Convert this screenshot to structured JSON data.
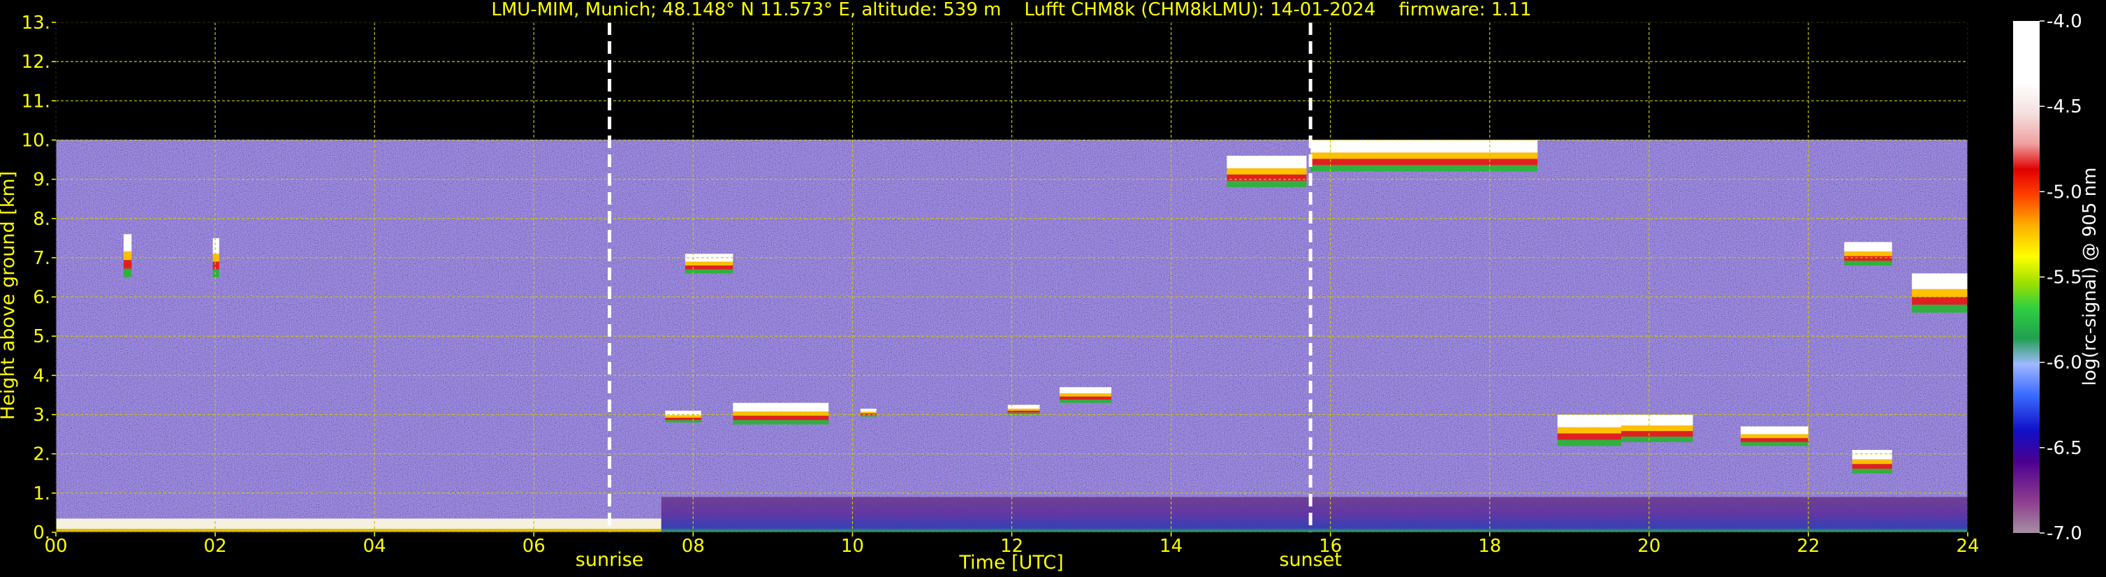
{
  "chart_data": {
    "type": "heatmap",
    "title": "LMU-MIM, Munich; 48.148° N 11.573° E, altitude: 539 m    Lufft CHM8k (CHM8kLMU): 14-01-2024    firmware: 1.11",
    "xlabel": "Time [UTC]",
    "ylabel": "Height above ground [km]",
    "xlim": [
      0,
      24
    ],
    "ylim": [
      0,
      13
    ],
    "x_ticks": [
      0,
      2,
      4,
      6,
      8,
      10,
      12,
      14,
      16,
      18,
      20,
      22,
      24
    ],
    "x_tick_labels": [
      "00",
      "02",
      "04",
      "06",
      "08",
      "10",
      "12",
      "14",
      "16",
      "18",
      "20",
      "22",
      "24"
    ],
    "y_ticks": [
      0,
      1,
      2,
      3,
      4,
      5,
      6,
      7,
      8,
      9,
      10,
      11,
      12,
      13
    ],
    "y_tick_labels": [
      "0.",
      "1.",
      "2.",
      "3.",
      "4.",
      "5.",
      "6.",
      "7.",
      "8.",
      "9.",
      "10.",
      "11.",
      "12.",
      "13."
    ],
    "grid": true,
    "data_top_km": 10,
    "markers": [
      {
        "label": "sunrise",
        "time": 6.95
      },
      {
        "label": "sunset",
        "time": 15.75
      }
    ],
    "colorbar": {
      "label": "log(rc-signal) @ 905 nm",
      "range": [
        -7.0,
        -4.0
      ],
      "ticks": [
        -4.0,
        -4.5,
        -5.0,
        -5.5,
        -6.0,
        -6.5,
        -7.0
      ],
      "tick_labels": [
        "-4.0",
        "-4.5",
        "-5.0",
        "-5.5",
        "-6.0",
        "-6.5",
        "-7.0"
      ]
    },
    "features": [
      {
        "kind": "cloud",
        "t0": 0.85,
        "t1": 0.95,
        "h0": 6.5,
        "h1": 7.6
      },
      {
        "kind": "cloud",
        "t0": 1.97,
        "t1": 2.05,
        "h0": 6.5,
        "h1": 7.5
      },
      {
        "kind": "cloud",
        "t0": 7.9,
        "t1": 8.5,
        "h0": 6.6,
        "h1": 7.1
      },
      {
        "kind": "cloud",
        "t0": 7.65,
        "t1": 8.1,
        "h0": 2.8,
        "h1": 3.1
      },
      {
        "kind": "cloud",
        "t0": 8.5,
        "t1": 9.7,
        "h0": 2.75,
        "h1": 3.3
      },
      {
        "kind": "cloud",
        "t0": 10.1,
        "t1": 10.3,
        "h0": 2.95,
        "h1": 3.15
      },
      {
        "kind": "cloud",
        "t0": 11.95,
        "t1": 12.35,
        "h0": 3.0,
        "h1": 3.25
      },
      {
        "kind": "cloud",
        "t0": 12.6,
        "t1": 13.25,
        "h0": 3.3,
        "h1": 3.7
      },
      {
        "kind": "cloud",
        "t0": 14.7,
        "t1": 15.7,
        "h0": 8.8,
        "h1": 9.6
      },
      {
        "kind": "cloud",
        "t0": 15.75,
        "t1": 18.6,
        "h0": 9.2,
        "h1": 10.0
      },
      {
        "kind": "cloud",
        "t0": 18.85,
        "t1": 19.65,
        "h0": 2.2,
        "h1": 3.0
      },
      {
        "kind": "cloud",
        "t0": 19.65,
        "t1": 20.55,
        "h0": 2.3,
        "h1": 3.0
      },
      {
        "kind": "cloud",
        "t0": 21.15,
        "t1": 22.0,
        "h0": 2.2,
        "h1": 2.7
      },
      {
        "kind": "cloud",
        "t0": 22.45,
        "t1": 23.05,
        "h0": 6.8,
        "h1": 7.4
      },
      {
        "kind": "cloud",
        "t0": 22.55,
        "t1": 23.05,
        "h0": 1.5,
        "h1": 2.1
      },
      {
        "kind": "cloud",
        "t0": 23.3,
        "t1": 24.0,
        "h0": 5.6,
        "h1": 6.6
      },
      {
        "kind": "surface_layer",
        "t0": 0,
        "t1": 7.6,
        "h0": 0.0,
        "h1": 0.35
      },
      {
        "kind": "boundary_layer",
        "t0": 7.6,
        "t1": 24.0,
        "h0": 0.0,
        "h1": 0.9
      },
      {
        "kind": "noisy_region",
        "t0": 0,
        "t1": 24.0,
        "h0": 0.9,
        "h1": 10.0
      }
    ]
  },
  "colors": {
    "axis_text": "#ffff00",
    "grid": "#c8c800",
    "colorbar_text": "#ffffff",
    "background": "#000000",
    "noise_base": "#3a2e6e",
    "boundary_layer": "#2a3ab0",
    "surface_layer": "#ffffff"
  }
}
